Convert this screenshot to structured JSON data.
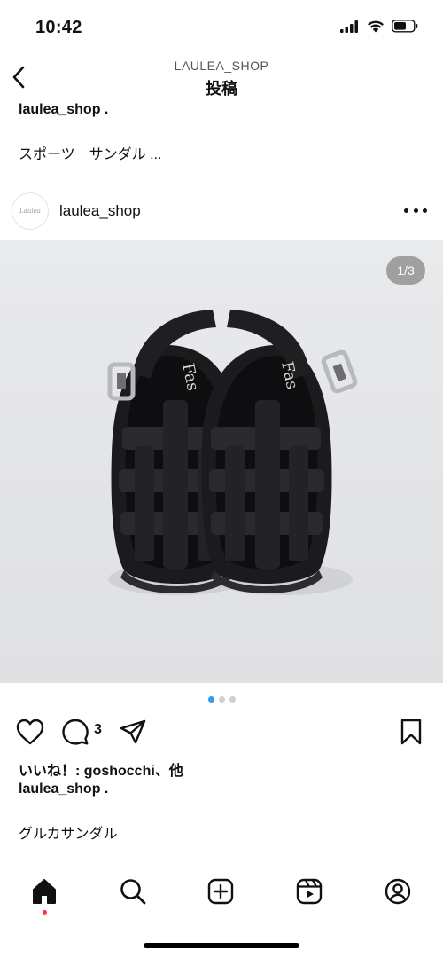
{
  "status": {
    "time": "10:42",
    "icons": [
      "signal-icon",
      "wifi-icon",
      "battery-icon"
    ]
  },
  "header": {
    "subtitle": "LAULEA_SHOP",
    "title": "投稿",
    "back_icon": "back-arrow-icon"
  },
  "previous_post": {
    "username": "laulea_shop .",
    "caption": "スポーツ　サンダル ..."
  },
  "post": {
    "username": "laulea_shop",
    "avatar_text": "Laulea",
    "image_subject": "black gurkha sandals",
    "image_text": "Fas",
    "page_counter": "1/3",
    "carousel": {
      "total": 3,
      "active_index": 0
    },
    "comment_count": "3",
    "likes_line": "いいね！: goshocchi、他",
    "caption_user": "laulea_shop .",
    "caption_text": "グルカサンダル"
  },
  "tab_bar": {
    "items": [
      "home-icon",
      "search-icon",
      "create-icon",
      "reels-icon",
      "profile-icon"
    ],
    "active": "home-icon"
  },
  "colors": {
    "background": "#ffffff",
    "image_background": "#e4e5e7",
    "carousel_active": "#3897f0",
    "notification_dot": "#ff3040",
    "text": "#111111"
  }
}
